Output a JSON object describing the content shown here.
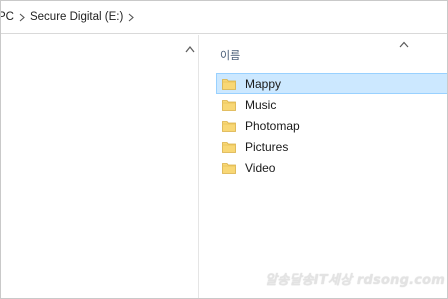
{
  "address_bar": {
    "crumbs": [
      "PC",
      "Secure Digital (E:)"
    ]
  },
  "icons": {
    "separator": "chevron-right-icon",
    "folder": "folder-icon",
    "sort": "sort-up-chevron-icon",
    "scroll_up": "scroll-up-arrow-icon"
  },
  "content": {
    "column_header": "이름",
    "items": [
      {
        "label": "Mappy",
        "selected": true
      },
      {
        "label": "Music",
        "selected": false
      },
      {
        "label": "Photomap",
        "selected": false
      },
      {
        "label": "Pictures",
        "selected": false
      },
      {
        "label": "Video",
        "selected": false
      }
    ]
  },
  "watermark": "알송달송IT세상 rdsong.com",
  "colors": {
    "selection_bg": "#cce8ff",
    "selection_border": "#99d1ff",
    "folder_yellow": "#f8d775",
    "header_text": "#4c607a"
  }
}
